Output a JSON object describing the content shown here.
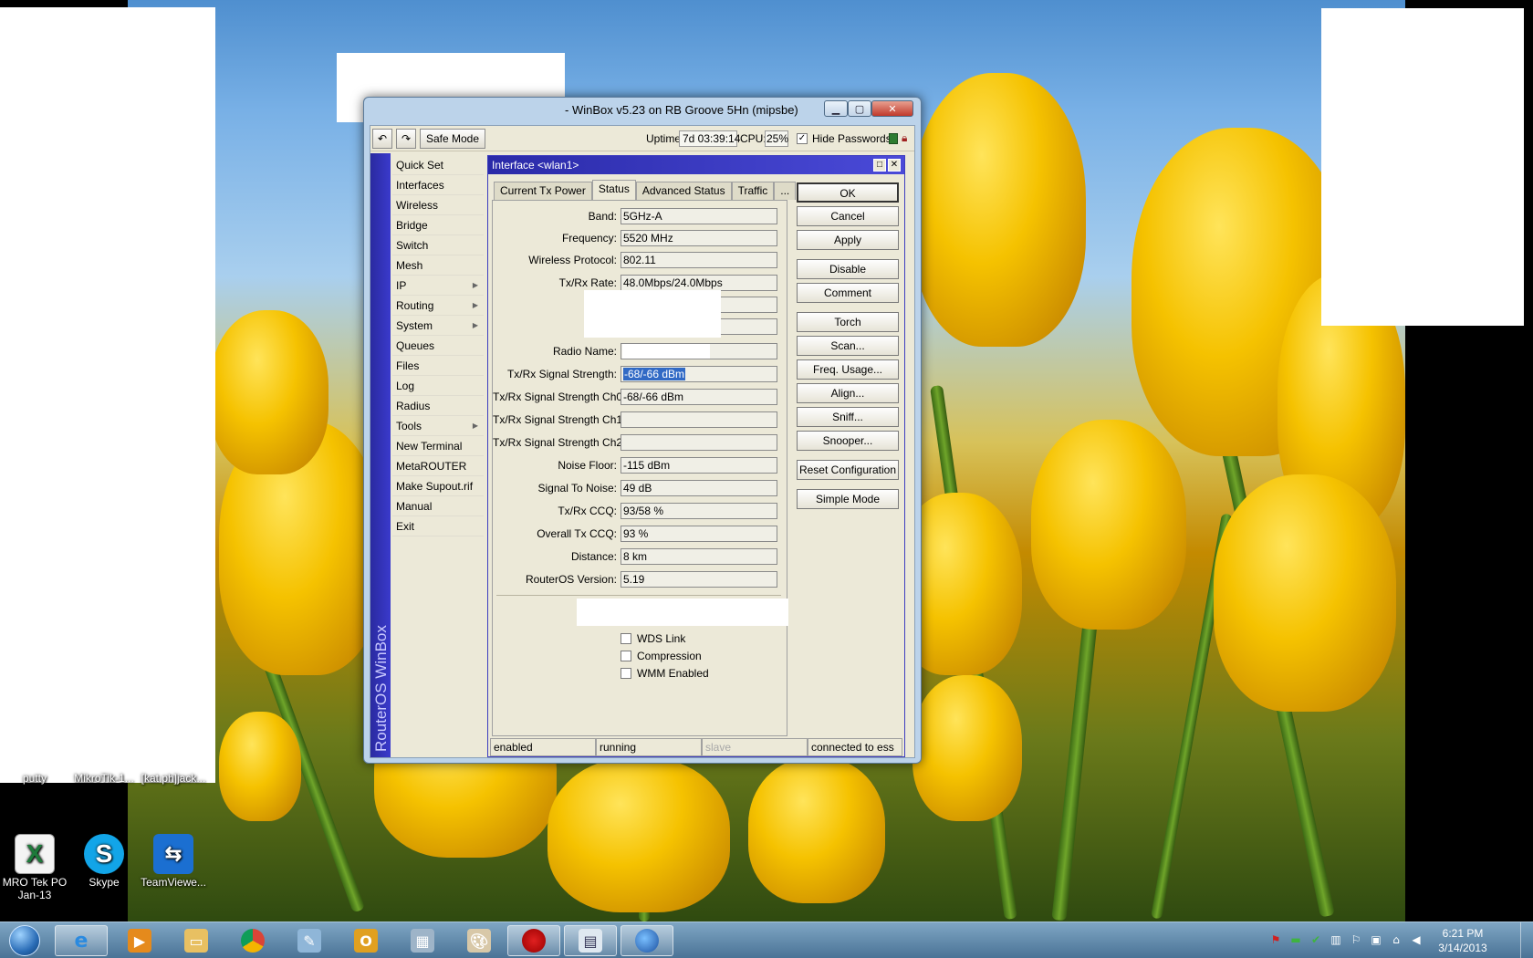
{
  "window": {
    "title": "- WinBox v5.23 on RB Groove 5Hn (mipsbe)"
  },
  "toolbar": {
    "safe_mode": "Safe Mode",
    "uptime_label": "Uptime:",
    "uptime_value": "7d 03:39:14",
    "cpu_label": "CPU:",
    "cpu_value": "25%",
    "hide_passwords": "Hide Passwords"
  },
  "sidebar": {
    "brand": "RouterOS WinBox",
    "items": [
      {
        "label": "Quick Set",
        "sub": false
      },
      {
        "label": "Interfaces",
        "sub": false
      },
      {
        "label": "Wireless",
        "sub": false
      },
      {
        "label": "Bridge",
        "sub": false
      },
      {
        "label": "Switch",
        "sub": false
      },
      {
        "label": "Mesh",
        "sub": false
      },
      {
        "label": "IP",
        "sub": true
      },
      {
        "label": "Routing",
        "sub": true
      },
      {
        "label": "System",
        "sub": true
      },
      {
        "label": "Queues",
        "sub": false
      },
      {
        "label": "Files",
        "sub": false
      },
      {
        "label": "Log",
        "sub": false
      },
      {
        "label": "Radius",
        "sub": false
      },
      {
        "label": "Tools",
        "sub": true
      },
      {
        "label": "New Terminal",
        "sub": false
      },
      {
        "label": "MetaROUTER",
        "sub": false
      },
      {
        "label": "Make Supout.rif",
        "sub": false
      },
      {
        "label": "Manual",
        "sub": false
      },
      {
        "label": "Exit",
        "sub": false
      }
    ]
  },
  "dialog": {
    "title": "Interface <wlan1>",
    "tabs": [
      "Current Tx Power",
      "Status",
      "Advanced Status",
      "Traffic",
      "..."
    ],
    "active_tab": "Status",
    "fields": {
      "band": {
        "label": "Band:",
        "value": "5GHz-A"
      },
      "frequency": {
        "label": "Frequency:",
        "value": "5520 MHz"
      },
      "protocol": {
        "label": "Wireless Protocol:",
        "value": "802.11"
      },
      "rate": {
        "label": "Tx/Rx Rate:",
        "value": "48.0Mbps/24.0Mbps"
      },
      "radio_name": {
        "label": "Radio Name:",
        "value": ""
      },
      "signal": {
        "label": "Tx/Rx Signal Strength:",
        "value": "-68/-66 dBm"
      },
      "signal_ch0": {
        "label": "Tx/Rx Signal Strength Ch0:",
        "value": "-68/-66 dBm"
      },
      "signal_ch1": {
        "label": "Tx/Rx Signal Strength Ch1:",
        "value": ""
      },
      "signal_ch2": {
        "label": "Tx/Rx Signal Strength Ch2:",
        "value": ""
      },
      "noise": {
        "label": "Noise Floor:",
        "value": "-115 dBm"
      },
      "snr": {
        "label": "Signal To Noise:",
        "value": "49 dB"
      },
      "ccq": {
        "label": "Tx/Rx CCQ:",
        "value": "93/58 %"
      },
      "overall_ccq": {
        "label": "Overall Tx CCQ:",
        "value": "93 %"
      },
      "distance": {
        "label": "Distance:",
        "value": "8 km"
      },
      "routeros": {
        "label": "RouterOS Version:",
        "value": "5.19"
      }
    },
    "checkboxes": {
      "wds": "WDS Link",
      "compression": "Compression",
      "wmm": "WMM Enabled"
    },
    "buttons": {
      "ok": "OK",
      "cancel": "Cancel",
      "apply": "Apply",
      "disable": "Disable",
      "comment": "Comment",
      "torch": "Torch",
      "scan": "Scan...",
      "freq_usage": "Freq. Usage...",
      "align": "Align...",
      "sniff": "Sniff...",
      "snooper": "Snooper...",
      "reset": "Reset Configuration",
      "simple": "Simple Mode"
    },
    "status": {
      "enabled": "enabled",
      "running": "running",
      "slave": "slave",
      "connected": "connected to ess"
    }
  },
  "desktop_icons": {
    "putty": "putty",
    "mikrotik": "MikroTik-1...",
    "katph": "[kat.ph]jack...",
    "mro_line1": "MRO Tek PO",
    "mro_line2": "Jan-13",
    "skype": "Skype",
    "teamviewer": "TeamViewe..."
  },
  "taskbar": {
    "time": "6:21 PM",
    "date": "3/14/2013"
  },
  "colors": {
    "winbox_blue": "#3a3acc",
    "selection": "#316ac5",
    "window_face": "#ece9d8"
  }
}
